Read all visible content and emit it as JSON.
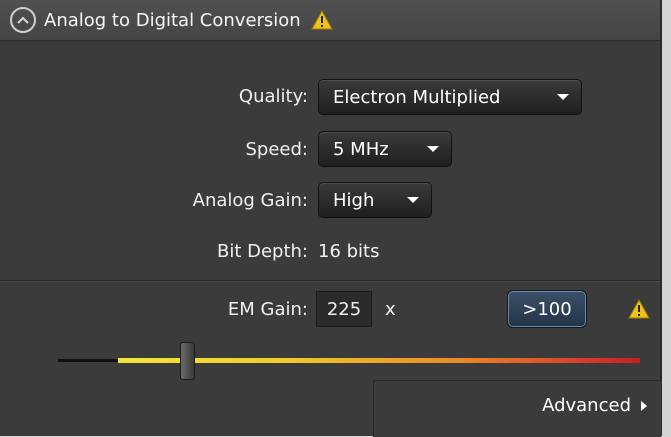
{
  "header": {
    "title": "Analog to Digital Conversion",
    "collapse_icon": "chevron-up-icon",
    "warning_icon": "warning-icon",
    "warning_color": "#f0c31a"
  },
  "settings": {
    "quality_label": "Quality:",
    "quality_value": "Electron Multiplied",
    "speed_label": "Speed:",
    "speed_value": "5 MHz",
    "analog_gain_label": "Analog Gain:",
    "analog_gain_value": "High",
    "bit_depth_label": "Bit Depth:",
    "bit_depth_value": "16 bits"
  },
  "em_gain": {
    "label": "EM Gain:",
    "value": "225",
    "unit": "x",
    "range_button": ">100",
    "warning_icon": "warning-icon",
    "slider_fraction": 0.22
  },
  "footer": {
    "advanced_label": "Advanced",
    "advanced_icon": "triangle-right-icon"
  },
  "colors": {
    "panel_bg": "#3b3b3b",
    "accent_button": "#2f435a",
    "slider_start": "#f2e63a",
    "slider_end": "#c81d24"
  }
}
